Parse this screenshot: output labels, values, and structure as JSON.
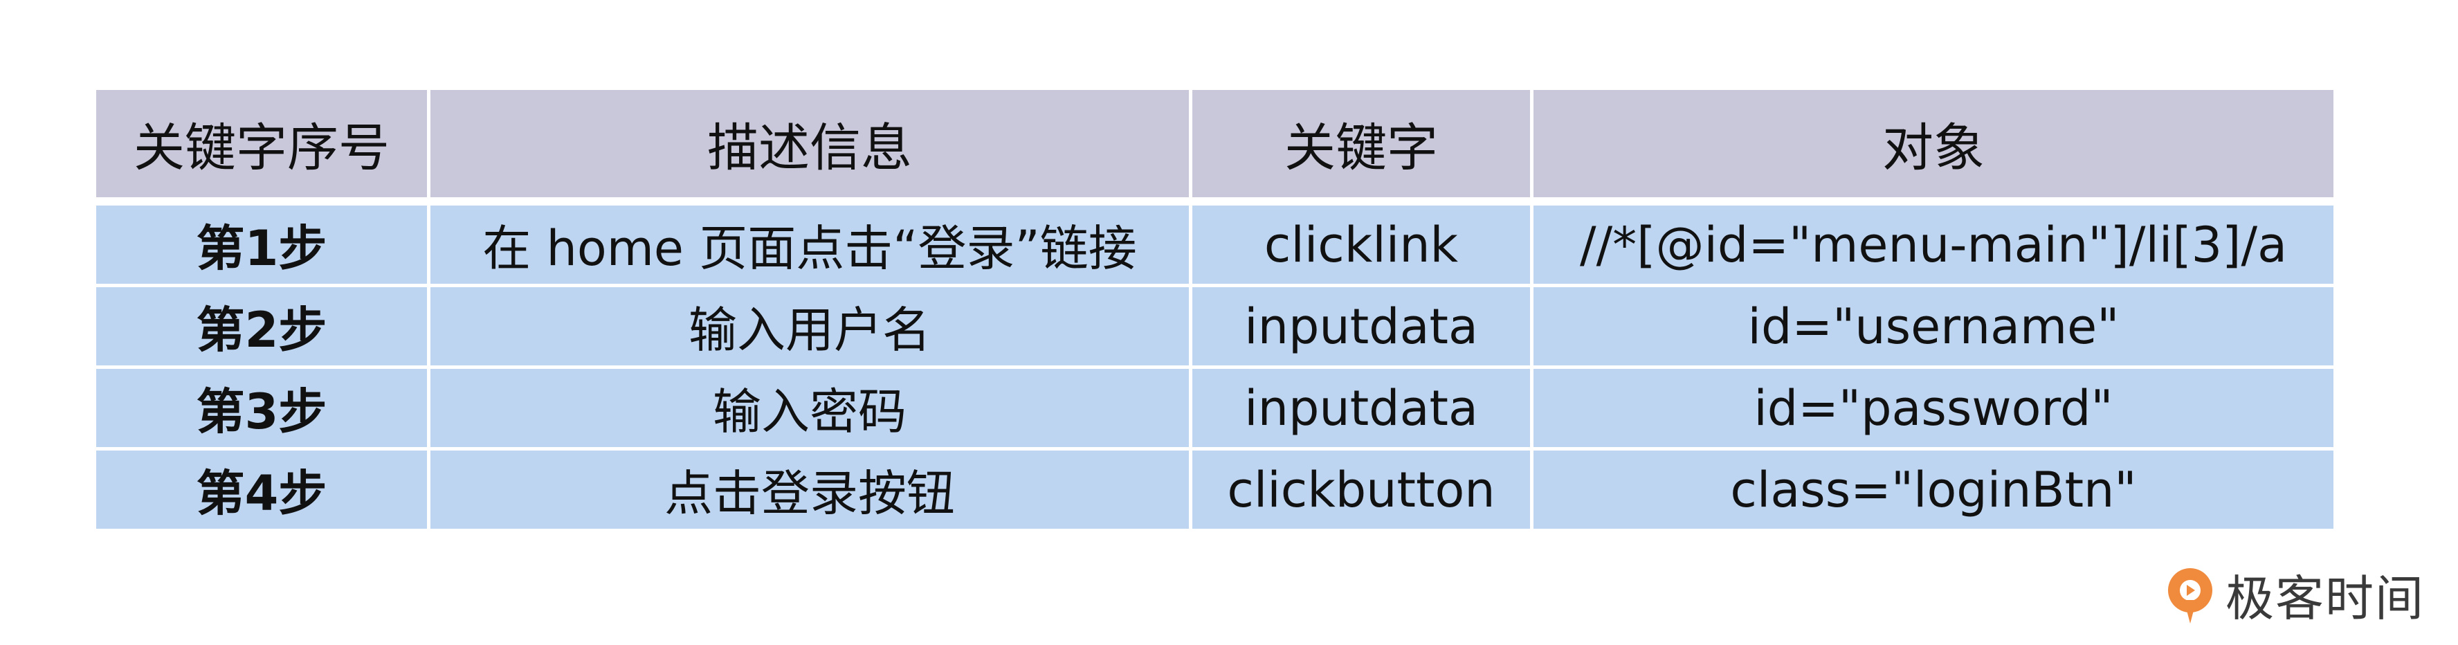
{
  "table": {
    "headers": [
      "关键字序号",
      "描述信息",
      "关键字",
      "对象"
    ],
    "rows": [
      {
        "step": "第1步",
        "desc": "在 home 页面点击“登录”链接",
        "keyword": "clicklink",
        "object": "//*[@id=\"menu-main\"]/li[3]/a"
      },
      {
        "step": "第2步",
        "desc": "输入用户名",
        "keyword": "inputdata",
        "object": "id=\"username\""
      },
      {
        "step": "第3步",
        "desc": "输入密码",
        "keyword": "inputdata",
        "object": "id=\"password\""
      },
      {
        "step": "第4步",
        "desc": "点击登录按钮",
        "keyword": "clickbutton",
        "object": "class=\"loginBtn\""
      }
    ]
  },
  "watermark": {
    "text": "极客时间",
    "icon": "geektime-logo-icon",
    "color": "#f08a3c"
  },
  "colors": {
    "header_bg": "#c9c8db",
    "row_bg": "#bdd5f1"
  }
}
